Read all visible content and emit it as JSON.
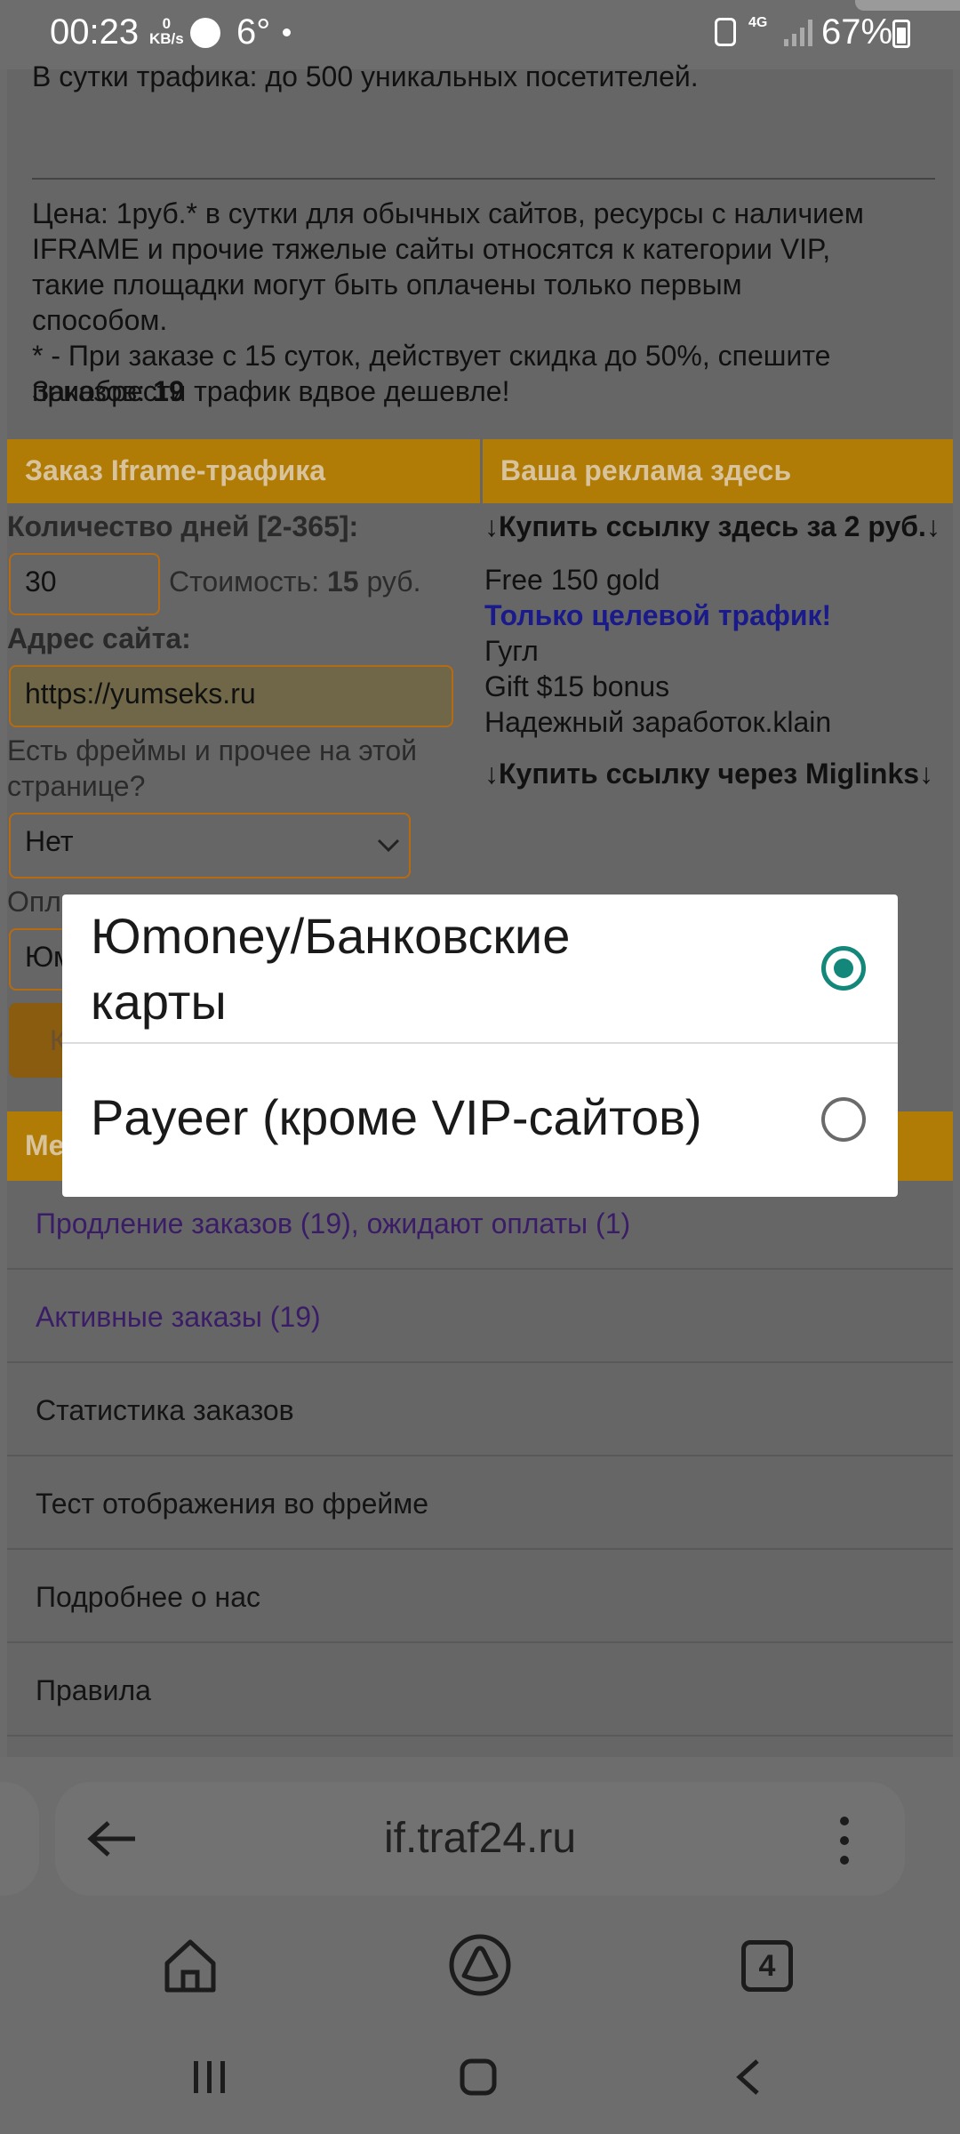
{
  "status_bar": {
    "time": "00:23",
    "net_speed_value": "0",
    "net_speed_unit": "KB/s",
    "temperature": "6°",
    "network": "4G",
    "battery": "67%"
  },
  "page": {
    "top_line": "В сутки трафика: до 500 уникальных посетителей.",
    "price_lines": [
      "Цена: 1руб.* в сутки для обычных сайтов, ресурсы с наличием",
      "IFRAME и прочие тяжелые сайты относятся к категории VIP,",
      "такие площадки могут быть оплачены только первым",
      "способом.",
      "* - При заказе с 15 суток, действует скидка до 50%, спешите",
      "приобрести трафик вдвое дешевле!"
    ],
    "orders_label": "Заказов:",
    "orders_count": "19",
    "form_header": "Заказ Iframe-трафика",
    "ads_header": "Ваша реклама здесь",
    "days_label": "Количество дней [2-365]:",
    "days_value": "30",
    "cost_label": "Стоимость:",
    "cost_value": "15",
    "cost_unit": "руб.",
    "site_label": "Адрес сайта:",
    "site_value": "https://yumseks.ru",
    "frames_question_1": "Есть фреймы и прочее на этой",
    "frames_question_2": "странице?",
    "frames_select": "Нет",
    "payment_label_partial": "Опл",
    "payment_select_partial": "Юм",
    "button_partial": "К",
    "menu_header_partial": "Ме",
    "ads": {
      "buy_here": "↓Купить ссылку здесь за 2 руб.↓",
      "links": [
        "Free 150 gold",
        "Только целевой трафик!",
        "Гугл",
        "Gift $15 bonus",
        "Надежный заработок.klain"
      ],
      "buy_miglinks": "↓Купить ссылку через Miglinks↓"
    },
    "menu": [
      "Продление заказов (19), ожидают оплаты (1)",
      "Активные заказы (19)",
      "Статистика заказов",
      "Тест отображения во фрейме",
      "Подробнее о нас",
      "Правила"
    ]
  },
  "dialog": {
    "options": [
      {
        "label_line1": "Юmoney/Банковские",
        "label_line2": "карты",
        "selected": true
      },
      {
        "label_line1": "Payeer (кроме VIP-сайтов)",
        "selected": false
      }
    ]
  },
  "browser": {
    "url": "if.traf24.ru",
    "tab_count": "4",
    "icons": [
      "back-arrow-icon",
      "more-vert-icon",
      "home-icon",
      "alice-icon",
      "tabs-icon",
      "recents-icon",
      "home-circle-icon",
      "back-chevron-icon"
    ]
  },
  "colors": {
    "accent_teal": "#12877a",
    "header_orange": "#b07c05",
    "dim_background": "#666666"
  }
}
